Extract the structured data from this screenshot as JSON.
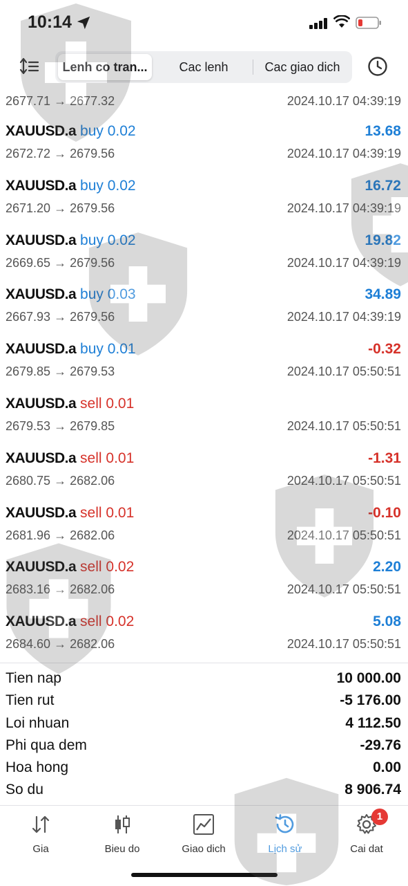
{
  "status": {
    "time": "10:14"
  },
  "toolbar": {
    "tabs": [
      {
        "label": "Lenh co tran..."
      },
      {
        "label": "Cac lenh"
      },
      {
        "label": "Cac giao dich"
      }
    ],
    "active_index": 0,
    "icons": [
      "sort-icon",
      "clock-icon"
    ]
  },
  "history": {
    "first": {
      "price": "2677.71 → 2677.32",
      "date": "2024.10.17 04:39:19"
    },
    "deals": [
      {
        "symbol": "XAUUSD.a",
        "side": "buy",
        "volume": "buy 0.02",
        "profit": "13.68",
        "price": "2672.72 → 2679.56",
        "date": "2024.10.17 04:39:19"
      },
      {
        "symbol": "XAUUSD.a",
        "side": "buy",
        "volume": "buy 0.02",
        "profit": "16.72",
        "price": "2671.20 → 2679.56",
        "date": "2024.10.17 04:39:19"
      },
      {
        "symbol": "XAUUSD.a",
        "side": "buy",
        "volume": "buy 0.02",
        "profit": "19.82",
        "price": "2669.65 → 2679.56",
        "date": "2024.10.17 04:39:19"
      },
      {
        "symbol": "XAUUSD.a",
        "side": "buy",
        "volume": "buy 0.03",
        "profit": "34.89",
        "price": "2667.93 → 2679.56",
        "date": "2024.10.17 04:39:19"
      },
      {
        "symbol": "XAUUSD.a",
        "side": "buy",
        "volume": "buy 0.01",
        "profit": "-0.32",
        "price": "2679.85 → 2679.53",
        "date": "2024.10.17 05:50:51"
      },
      {
        "symbol": "XAUUSD.a",
        "side": "sell",
        "volume": "sell 0.01",
        "profit": "",
        "price": "2679.53 → 2679.85",
        "date": "2024.10.17 05:50:51"
      },
      {
        "symbol": "XAUUSD.a",
        "side": "sell",
        "volume": "sell 0.01",
        "profit": "-1.31",
        "price": "2680.75 → 2682.06",
        "date": "2024.10.17 05:50:51"
      },
      {
        "symbol": "XAUUSD.a",
        "side": "sell",
        "volume": "sell 0.01",
        "profit": "-0.10",
        "price": "2681.96 → 2682.06",
        "date": "2024.10.17 05:50:51"
      },
      {
        "symbol": "XAUUSD.a",
        "side": "sell",
        "volume": "sell 0.02",
        "profit": "2.20",
        "price": "2683.16 → 2682.06",
        "date": "2024.10.17 05:50:51"
      },
      {
        "symbol": "XAUUSD.a",
        "side": "sell",
        "volume": "sell 0.02",
        "profit": "5.08",
        "price": "2684.60 → 2682.06",
        "date": "2024.10.17 05:50:51"
      }
    ]
  },
  "summary": [
    {
      "label": "Tien nap",
      "value": "10 000.00"
    },
    {
      "label": "Tien rut",
      "value": "-5 176.00"
    },
    {
      "label": "Loi nhuan",
      "value": "4 112.50"
    },
    {
      "label": "Phi qua dem",
      "value": "-29.76"
    },
    {
      "label": "Hoa hong",
      "value": "0.00"
    },
    {
      "label": "So du",
      "value": "8 906.74"
    }
  ],
  "tabbar": {
    "items": [
      {
        "label": "Gia",
        "icon": "arrows-icon"
      },
      {
        "label": "Bieu do",
        "icon": "candles-icon"
      },
      {
        "label": "Giao dich",
        "icon": "trade-chart-icon"
      },
      {
        "label": "Lịch sử",
        "icon": "history-icon"
      },
      {
        "label": "Cai dat",
        "icon": "gear-icon"
      }
    ],
    "active_index": 3,
    "badge": "1"
  },
  "colors": {
    "buy": "#1e7fd6",
    "sell": "#d6322a",
    "active": "#1e7fd6"
  }
}
